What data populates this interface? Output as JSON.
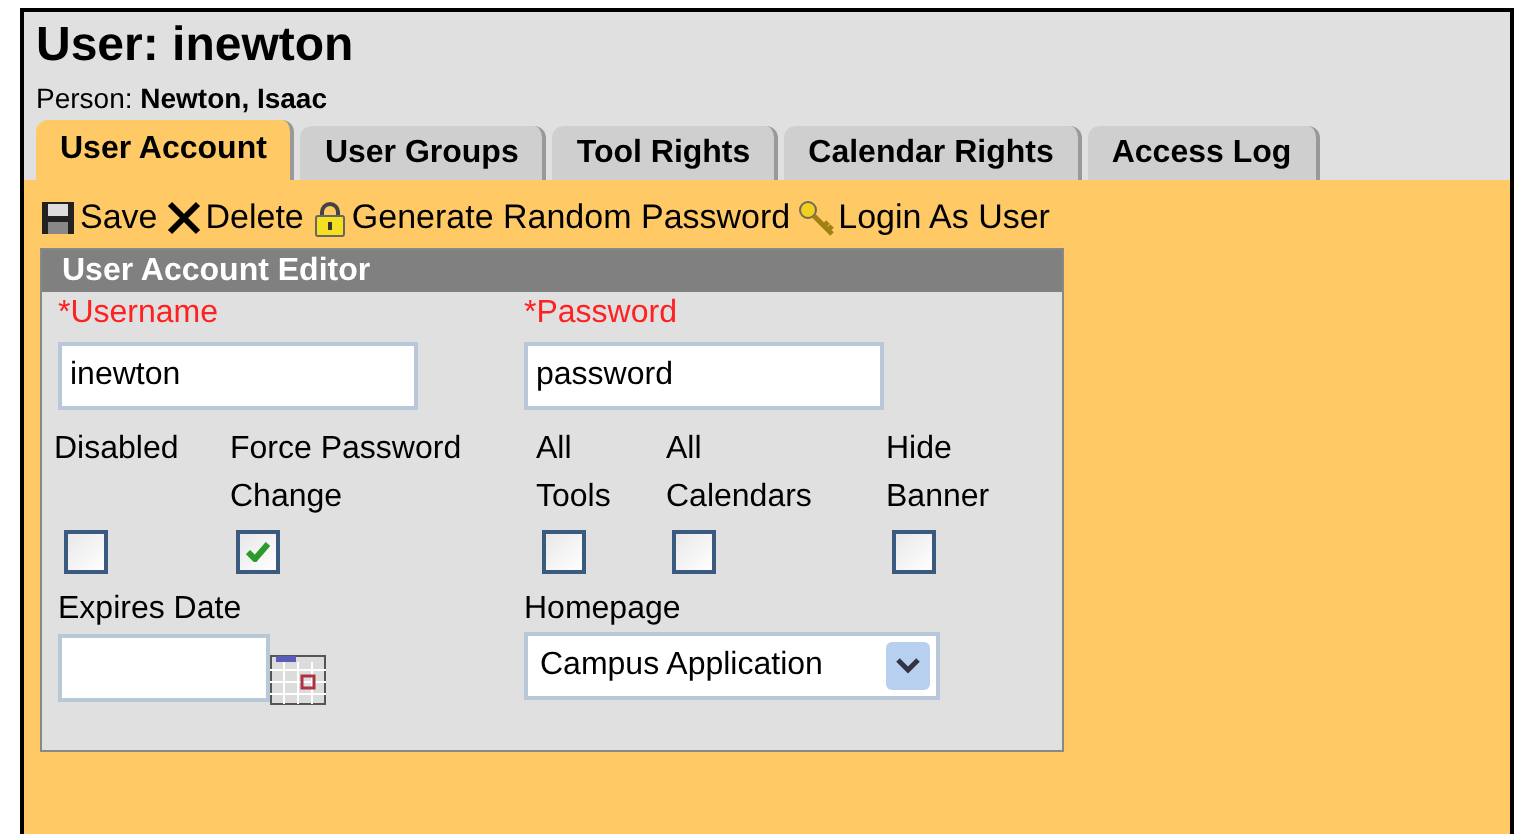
{
  "header": {
    "title": "User: inewton",
    "person": "Person: **Newton, Isaac**"
  },
  "tabs": [
    {
      "label": "User Account",
      "selected": true
    },
    {
      "label": "User Groups",
      "selected": false
    },
    {
      "label": "Tool Rights",
      "selected": false
    },
    {
      "label": "Calendar Rights",
      "selected": false
    },
    {
      "label": "Access Log",
      "selected": false
    }
  ],
  "toolbar": [
    {
      "kind": "save",
      "label": "Save"
    },
    {
      "kind": "delete",
      "label": "Delete"
    },
    {
      "kind": "lock",
      "label": "Generate Random Password"
    },
    {
      "kind": "key",
      "label": "Login As User"
    }
  ],
  "editor": {
    "title": "User Account Editor",
    "username": {
      "label": "*Username",
      "value": "inewton"
    },
    "password": {
      "label": "*Password",
      "value": "password"
    },
    "checkboxes": [
      {
        "label": "Disabled",
        "checked": false
      },
      {
        "label": "Force Password Change",
        "checked": true
      },
      {
        "label": "All Tools",
        "checked": false
      },
      {
        "label": "All Calendars",
        "checked": false
      },
      {
        "label": "Hide Banner",
        "checked": false
      }
    ],
    "expires": {
      "label": "Expires Date"
    },
    "homepage": {
      "label": "Homepage",
      "value": "Campus Application"
    }
  }
}
